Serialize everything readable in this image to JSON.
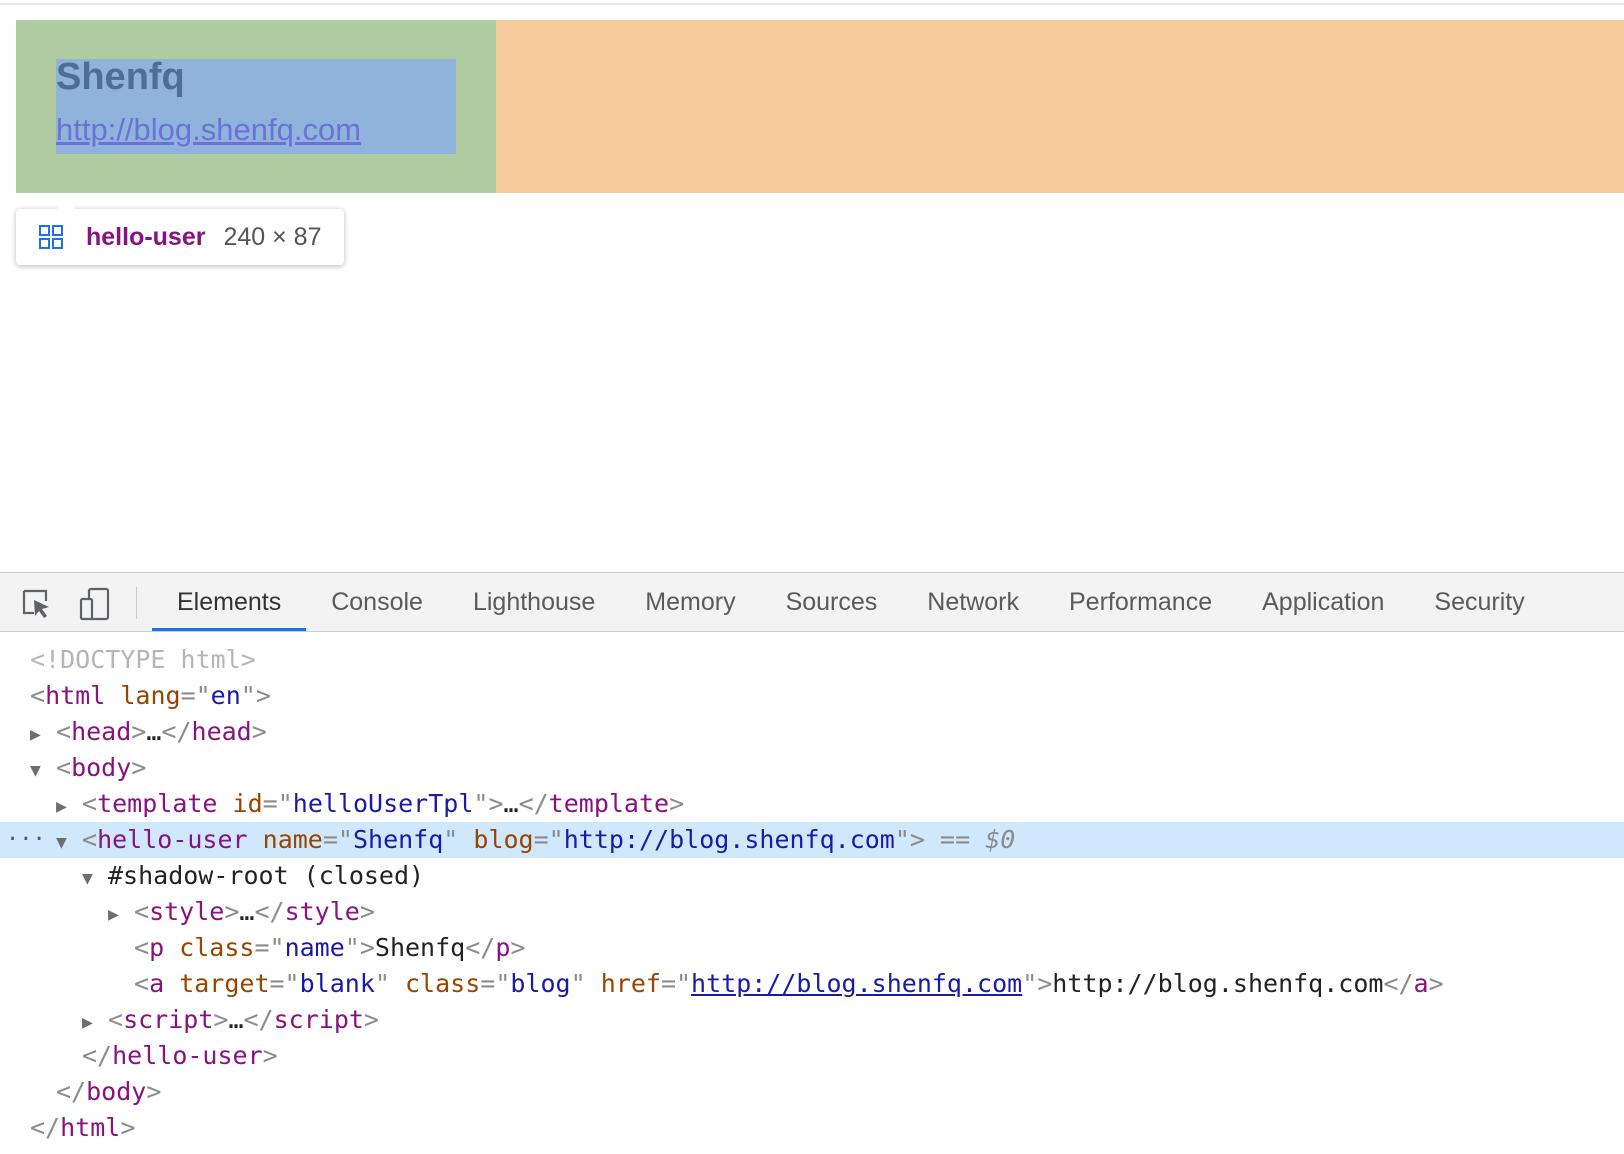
{
  "page": {
    "user_name": "Shenfq",
    "user_blog": "http://blog.shenfq.com"
  },
  "tooltip": {
    "tag": "hello-user",
    "size": "240 × 87",
    "icon": "grid-layout-icon"
  },
  "devtools": {
    "tabs": [
      "Elements",
      "Console",
      "Lighthouse",
      "Memory",
      "Sources",
      "Network",
      "Performance",
      "Application",
      "Security"
    ],
    "active_tab": "Elements",
    "dom": {
      "doctype": "<!DOCTYPE html>",
      "html_open": "html",
      "lang_attr": "lang",
      "lang_val": "en",
      "head": "head",
      "body": "body",
      "template": "template",
      "template_id_attr": "id",
      "template_id_val": "helloUserTpl",
      "host_tag": "hello-user",
      "host_name_attr": "name",
      "host_name_val": "Shenfq",
      "host_blog_attr": "blog",
      "host_blog_val": "http://blog.shenfq.com",
      "selected_marker": "== $0",
      "shadow_root": "#shadow-root (closed)",
      "style": "style",
      "p_tag": "p",
      "p_class_attr": "class",
      "p_class_val": "name",
      "p_text": "Shenfq",
      "a_tag": "a",
      "a_target_attr": "target",
      "a_target_val": "blank",
      "a_class_attr": "class",
      "a_class_val": "blog",
      "a_href_attr": "href",
      "a_href_val": "http://blog.shenfq.com",
      "a_text": "http://blog.shenfq.com",
      "script": "script",
      "ellipsis": "…",
      "overflow_dots": "···"
    }
  },
  "colors": {
    "margin": "#f8cb9d",
    "padding": "#b0cba0",
    "content": "#90b3dc",
    "tag": "#881280",
    "attr_name": "#994500",
    "attr_value": "#1a1aa6",
    "selected_row": "#cfe8fc",
    "active_tab_indicator": "#1a73e8"
  }
}
